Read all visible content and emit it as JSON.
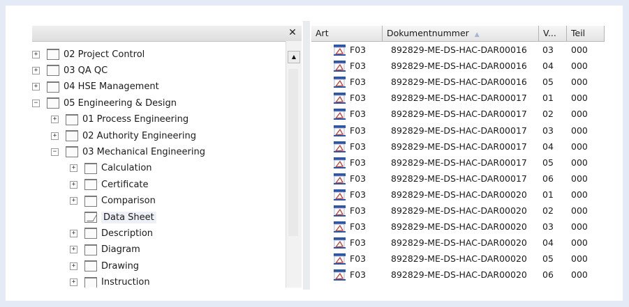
{
  "tree": {
    "close_glyph": "✕",
    "items": [
      {
        "label": "02 Project Control",
        "level": 0,
        "expander": "+",
        "open": false,
        "selected": false
      },
      {
        "label": "03 QA QC",
        "level": 0,
        "expander": "+",
        "open": false,
        "selected": false
      },
      {
        "label": "04 HSE Management",
        "level": 0,
        "expander": "+",
        "open": false,
        "selected": false
      },
      {
        "label": "05 Engineering & Design",
        "level": 0,
        "expander": "−",
        "open": false,
        "selected": false
      },
      {
        "label": "01 Process Engineering",
        "level": 1,
        "expander": "+",
        "open": false,
        "selected": false
      },
      {
        "label": "02 Authority Engineering",
        "level": 1,
        "expander": "+",
        "open": false,
        "selected": false
      },
      {
        "label": "03 Mechanical Engineering",
        "level": 1,
        "expander": "−",
        "open": false,
        "selected": false
      },
      {
        "label": "Calculation",
        "level": 2,
        "expander": "+",
        "open": false,
        "selected": false
      },
      {
        "label": "Certificate",
        "level": 2,
        "expander": "+",
        "open": false,
        "selected": false
      },
      {
        "label": "Comparison",
        "level": 2,
        "expander": "+",
        "open": false,
        "selected": false
      },
      {
        "label": "Data Sheet",
        "level": 2,
        "expander": "",
        "open": true,
        "selected": true
      },
      {
        "label": "Description",
        "level": 2,
        "expander": "+",
        "open": false,
        "selected": false
      },
      {
        "label": "Diagram",
        "level": 2,
        "expander": "+",
        "open": false,
        "selected": false
      },
      {
        "label": "Drawing",
        "level": 2,
        "expander": "+",
        "open": false,
        "selected": false
      },
      {
        "label": "Instruction",
        "level": 2,
        "expander": "+",
        "open": false,
        "selected": false
      }
    ]
  },
  "list": {
    "columns": [
      {
        "key": "art",
        "label": "Art"
      },
      {
        "key": "dokumentnummer",
        "label": "Dokumentnummer",
        "sorted": "asc"
      },
      {
        "key": "version",
        "label": "V..."
      },
      {
        "key": "teil",
        "label": "Teil"
      }
    ],
    "icon": "pdf-document-icon",
    "rows": [
      {
        "art": "F03",
        "doc": "892829-ME-DS-HAC-DAR00016",
        "v": "03",
        "teil": "000"
      },
      {
        "art": "F03",
        "doc": "892829-ME-DS-HAC-DAR00016",
        "v": "04",
        "teil": "000"
      },
      {
        "art": "F03",
        "doc": "892829-ME-DS-HAC-DAR00016",
        "v": "05",
        "teil": "000"
      },
      {
        "art": "F03",
        "doc": "892829-ME-DS-HAC-DAR00017",
        "v": "01",
        "teil": "000"
      },
      {
        "art": "F03",
        "doc": "892829-ME-DS-HAC-DAR00017",
        "v": "02",
        "teil": "000"
      },
      {
        "art": "F03",
        "doc": "892829-ME-DS-HAC-DAR00017",
        "v": "03",
        "teil": "000"
      },
      {
        "art": "F03",
        "doc": "892829-ME-DS-HAC-DAR00017",
        "v": "04",
        "teil": "000"
      },
      {
        "art": "F03",
        "doc": "892829-ME-DS-HAC-DAR00017",
        "v": "05",
        "teil": "000"
      },
      {
        "art": "F03",
        "doc": "892829-ME-DS-HAC-DAR00017",
        "v": "06",
        "teil": "000"
      },
      {
        "art": "F03",
        "doc": "892829-ME-DS-HAC-DAR00020",
        "v": "01",
        "teil": "000"
      },
      {
        "art": "F03",
        "doc": "892829-ME-DS-HAC-DAR00020",
        "v": "02",
        "teil": "000"
      },
      {
        "art": "F03",
        "doc": "892829-ME-DS-HAC-DAR00020",
        "v": "03",
        "teil": "000"
      },
      {
        "art": "F03",
        "doc": "892829-ME-DS-HAC-DAR00020",
        "v": "04",
        "teil": "000"
      },
      {
        "art": "F03",
        "doc": "892829-ME-DS-HAC-DAR00020",
        "v": "05",
        "teil": "000"
      },
      {
        "art": "F03",
        "doc": "892829-ME-DS-HAC-DAR00020",
        "v": "06",
        "teil": "000"
      }
    ]
  },
  "colors": {
    "background": "#e4ebf6",
    "pdf_icon_blue": "#2f55a6",
    "sort_arrow": "#a7b7d2"
  }
}
